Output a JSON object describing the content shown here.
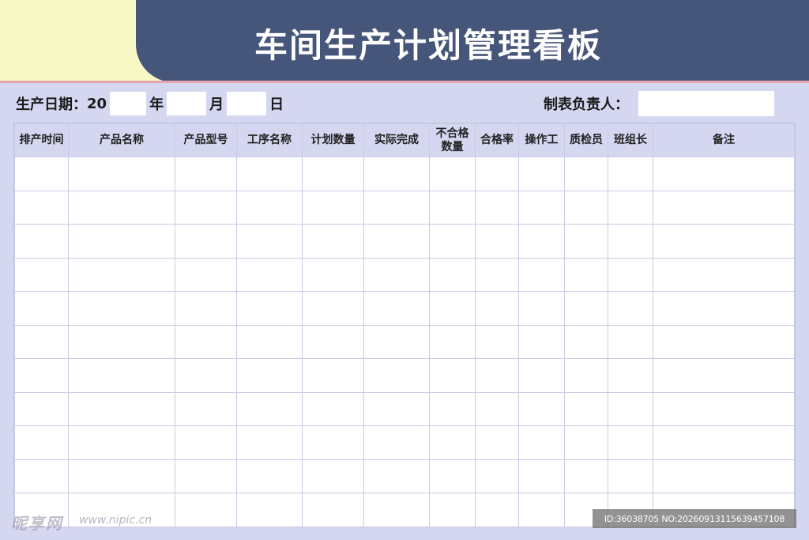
{
  "title": "车间生产计划管理看板",
  "date_row": {
    "label": "生产日期：",
    "year_prefix": "20",
    "year_unit": "年",
    "month_unit": "月",
    "day_unit": "日"
  },
  "maker": {
    "label": "制表负责人："
  },
  "table": {
    "columns": [
      "排产时间",
      "产品名称",
      "产品型号",
      "工序名称",
      "计划数量",
      "实际完成",
      "不合格\n数量",
      "合格率",
      "操作工",
      "质检员",
      "班组长",
      "备注"
    ],
    "row_count": 11
  },
  "watermark": {
    "brand": "昵享网",
    "url": "www.nipic.cn",
    "id_text": "ID:36038705 NO:20260913115639457108"
  },
  "colors": {
    "header_band": "#46557a",
    "top_left": "#f8f8c6",
    "board_bg": "#d5d7f1",
    "accent_line": "#e8a3b0"
  }
}
